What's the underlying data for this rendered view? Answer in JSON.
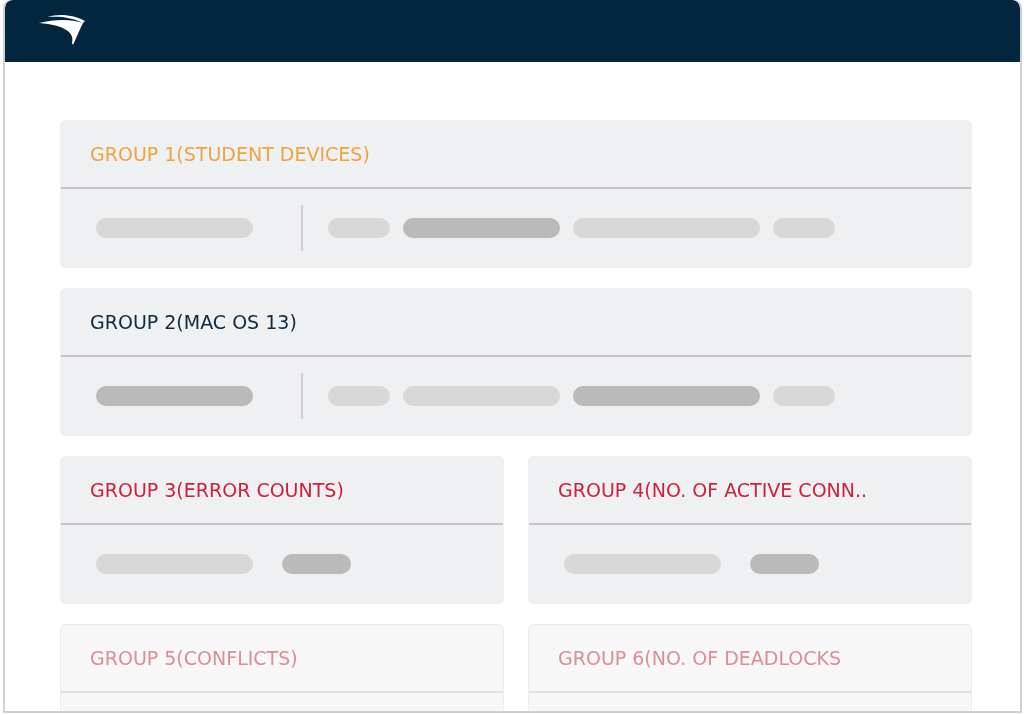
{
  "groups": [
    {
      "title": "GROUP 1(STUDENT DEVICES)",
      "color": "#f0a23c",
      "kind": "wide",
      "faded": false,
      "lead": [
        {
          "kind": "long",
          "color": "#d8d8d9"
        }
      ],
      "bars": [
        {
          "kind": "short",
          "color": "#d8d8d9"
        },
        {
          "kind": "long",
          "color": "#bababb"
        },
        {
          "kind": "xlong",
          "color": "#d8d8d9"
        },
        {
          "kind": "short",
          "color": "#d8d8d9"
        }
      ]
    },
    {
      "title": "GROUP 2(MAC OS 13)",
      "color": "#0d2a40",
      "kind": "wide",
      "faded": false,
      "lead": [
        {
          "kind": "long",
          "color": "#bababb"
        }
      ],
      "bars": [
        {
          "kind": "short",
          "color": "#d8d8d9"
        },
        {
          "kind": "long",
          "color": "#d8d8d9"
        },
        {
          "kind": "xlong",
          "color": "#bababb"
        },
        {
          "kind": "short",
          "color": "#d8d8d9"
        }
      ]
    },
    {
      "title": "GROUP 3(ERROR COUNTS)",
      "color": "#d0213a",
      "kind": "half",
      "faded": false,
      "bars": [
        {
          "kind": "long",
          "color": "#d8d8d9"
        },
        {
          "kind": "medium",
          "color": "#bababb"
        }
      ]
    },
    {
      "title": "GROUP 4(NO. OF ACTIVE CONN..",
      "color": "#d0213a",
      "kind": "half",
      "faded": false,
      "bars": [
        {
          "kind": "long",
          "color": "#d8d8d9"
        },
        {
          "kind": "medium",
          "color": "#bababb"
        }
      ]
    },
    {
      "title": "GROUP 5(CONFLICTS)",
      "color": "#de8c99",
      "kind": "half",
      "faded": true
    },
    {
      "title": "GROUP 6(NO. OF DEADLOCKS",
      "color": "#de8c99",
      "kind": "half",
      "faded": true
    }
  ]
}
